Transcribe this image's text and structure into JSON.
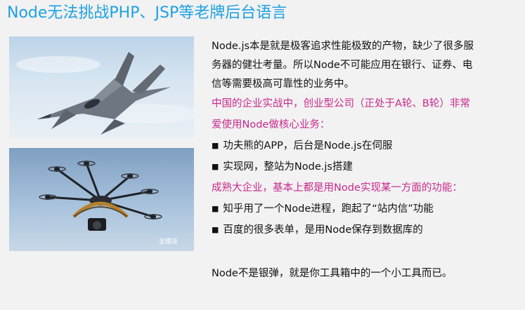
{
  "slide": {
    "title": "Node无法挑战PHP、JSP等老牌后台语言"
  },
  "images": [
    {
      "icon": "fighter-jet-photo"
    },
    {
      "icon": "camera-drone-photo",
      "watermark": "全媒派"
    }
  ],
  "text": {
    "intro_line1": "Node.js本是就是极客追求性能极致的产物，缺少了很多服",
    "intro_line2": "务器的健壮考量。所以Node不可能应用在银行、证券、电",
    "intro_line3": "信等需要极高可靠性的业务中。",
    "china_line1": "中国的企业实战中，创业型公司（正处于A轮、B轮）非常",
    "china_line2": "爱使用Node做核心业务：",
    "bullet_marker": "■",
    "startup_bullets": [
      "功夫熊的APP，后台是Node.js在伺服",
      "实现网，整站为Node.js搭建"
    ],
    "mature_heading": "成熟大企业，基本上都是用Node实现某一方面的功能：",
    "mature_bullets": [
      "知乎用了一个Node进程，跑起了“站内信”功能",
      "百度的很多表单，是用Node保存到数据库的"
    ],
    "conclusion": "Node不是银弹，就是你工具箱中的一个小工具而已。"
  },
  "colors": {
    "title": "#1da1e2",
    "highlight": "#c8288c",
    "body_text": "#111111",
    "background": "#f2f2f2"
  }
}
